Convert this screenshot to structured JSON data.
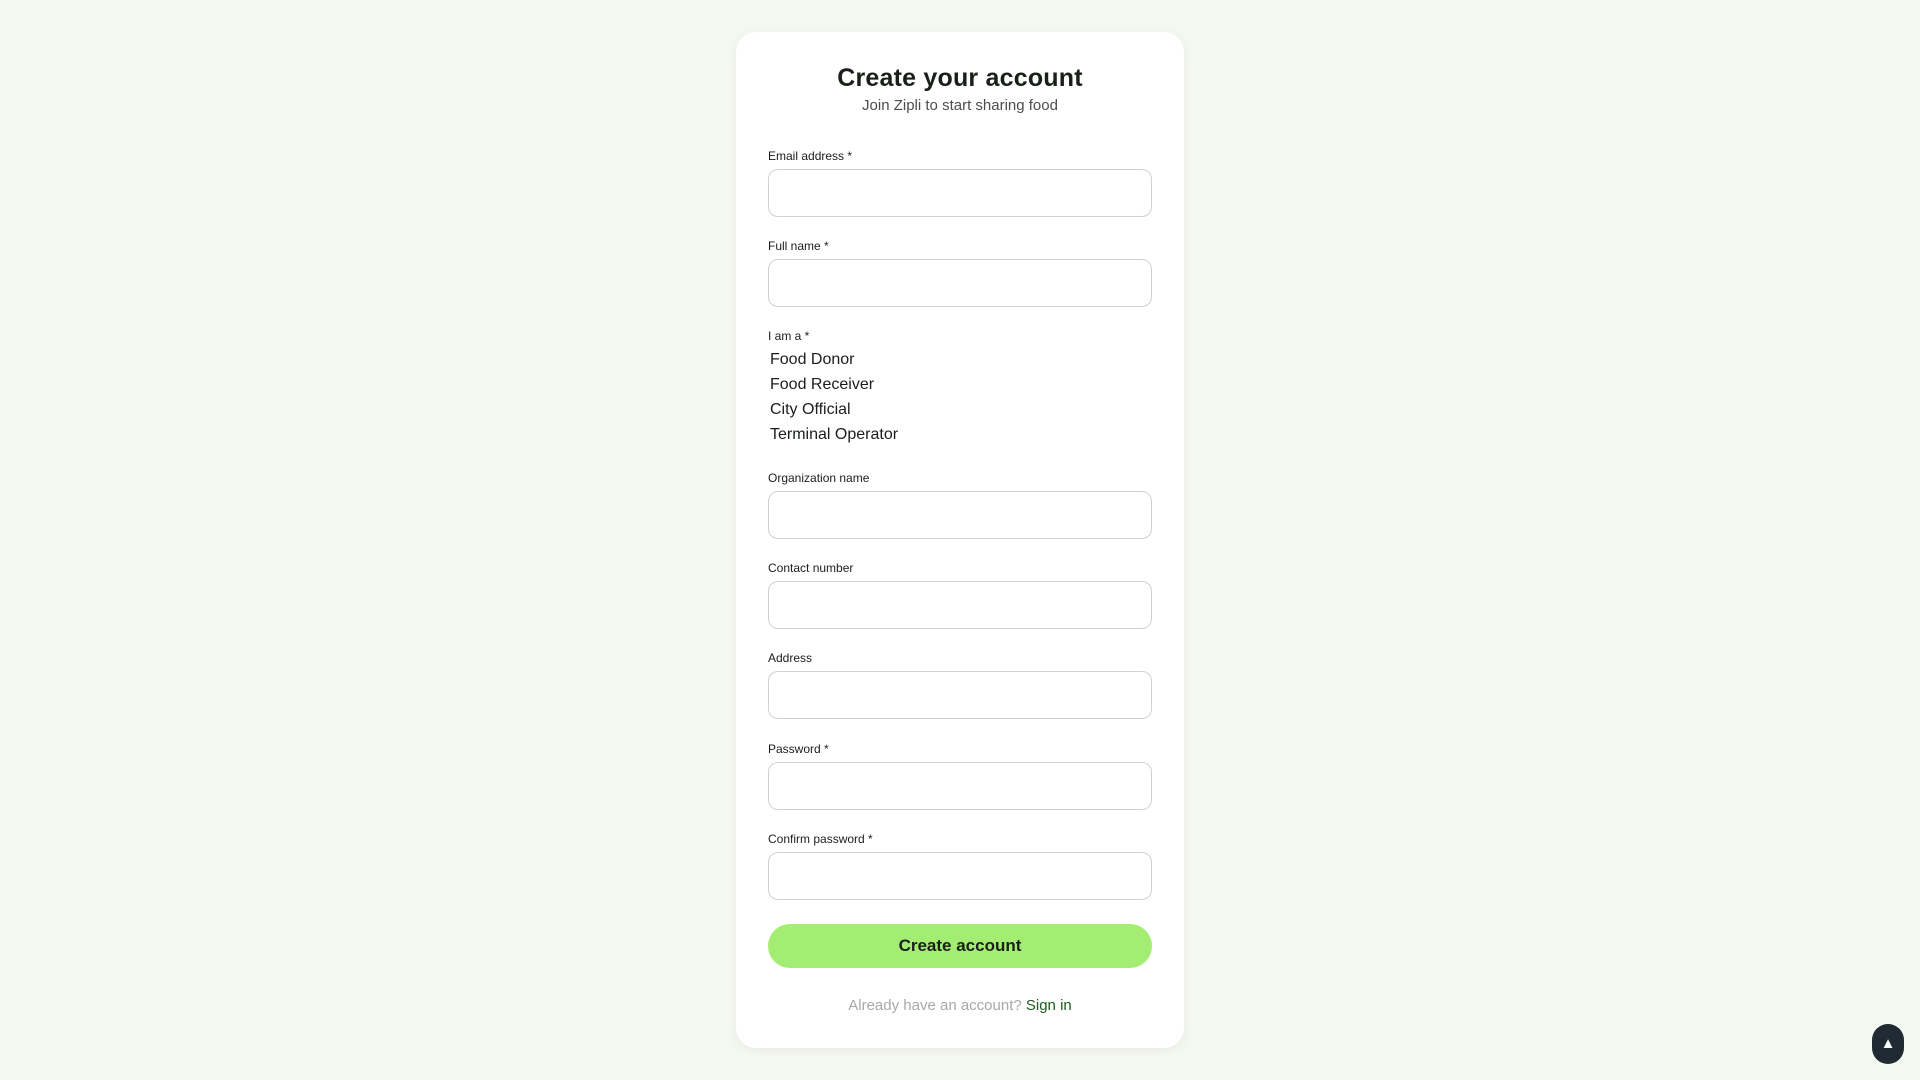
{
  "form": {
    "title": "Create your account",
    "subtitle": "Join Zipli to start sharing food",
    "email_label": "Email address *",
    "fullname_label": "Full name *",
    "role_label": "I am a *",
    "roles": [
      "Food Donor",
      "Food Receiver",
      "City Official",
      "Terminal Operator"
    ],
    "organization_label": "Organization name",
    "contact_label": "Contact number",
    "address_label": "Address",
    "password_label": "Password *",
    "confirm_password_label": "Confirm password *",
    "submit_label": "Create account",
    "signin_prompt": "Already have an account?",
    "signin_link": "Sign in"
  },
  "scroll_top": {
    "icon": "up-arrow-icon",
    "glyph": "▲"
  },
  "colors": {
    "background": "#f5f8f0",
    "card": "#ffffff",
    "accent": "#a3ed72",
    "link": "#1d5a1d",
    "muted": "#a5aaa5"
  }
}
